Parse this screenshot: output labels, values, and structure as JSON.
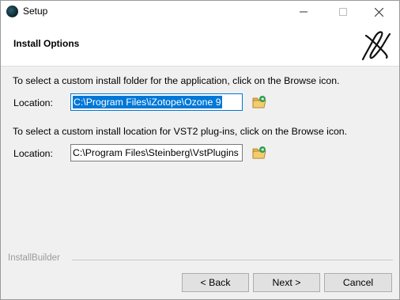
{
  "window": {
    "title": "Setup",
    "minimize_glyph": "—",
    "maximize_glyph": "☐",
    "close_glyph": "✕"
  },
  "header": {
    "title": "Install Options",
    "logo_icon": "izotope-logo-icon"
  },
  "content": {
    "app_folder": {
      "instruction": "To select a custom install folder for the application, click on the Browse icon.",
      "label": "Location:",
      "value": "C:\\Program Files\\iZotope\\Ozone 9",
      "browse_icon": "folder-browse-icon"
    },
    "vst2_folder": {
      "instruction": "To select a custom install location for VST2 plug-ins, click on the Browse icon.",
      "label": "Location:",
      "value": "C:\\Program Files\\Steinberg\\VstPlugins",
      "browse_icon": "folder-browse-icon"
    }
  },
  "footer": {
    "brand": "InstallBuilder",
    "back_label": "< Back",
    "next_label": "Next >",
    "cancel_label": "Cancel"
  },
  "colors": {
    "selection": "#0078d7",
    "button_face": "#e1e1e1",
    "window_bg": "#f0f0f0"
  }
}
